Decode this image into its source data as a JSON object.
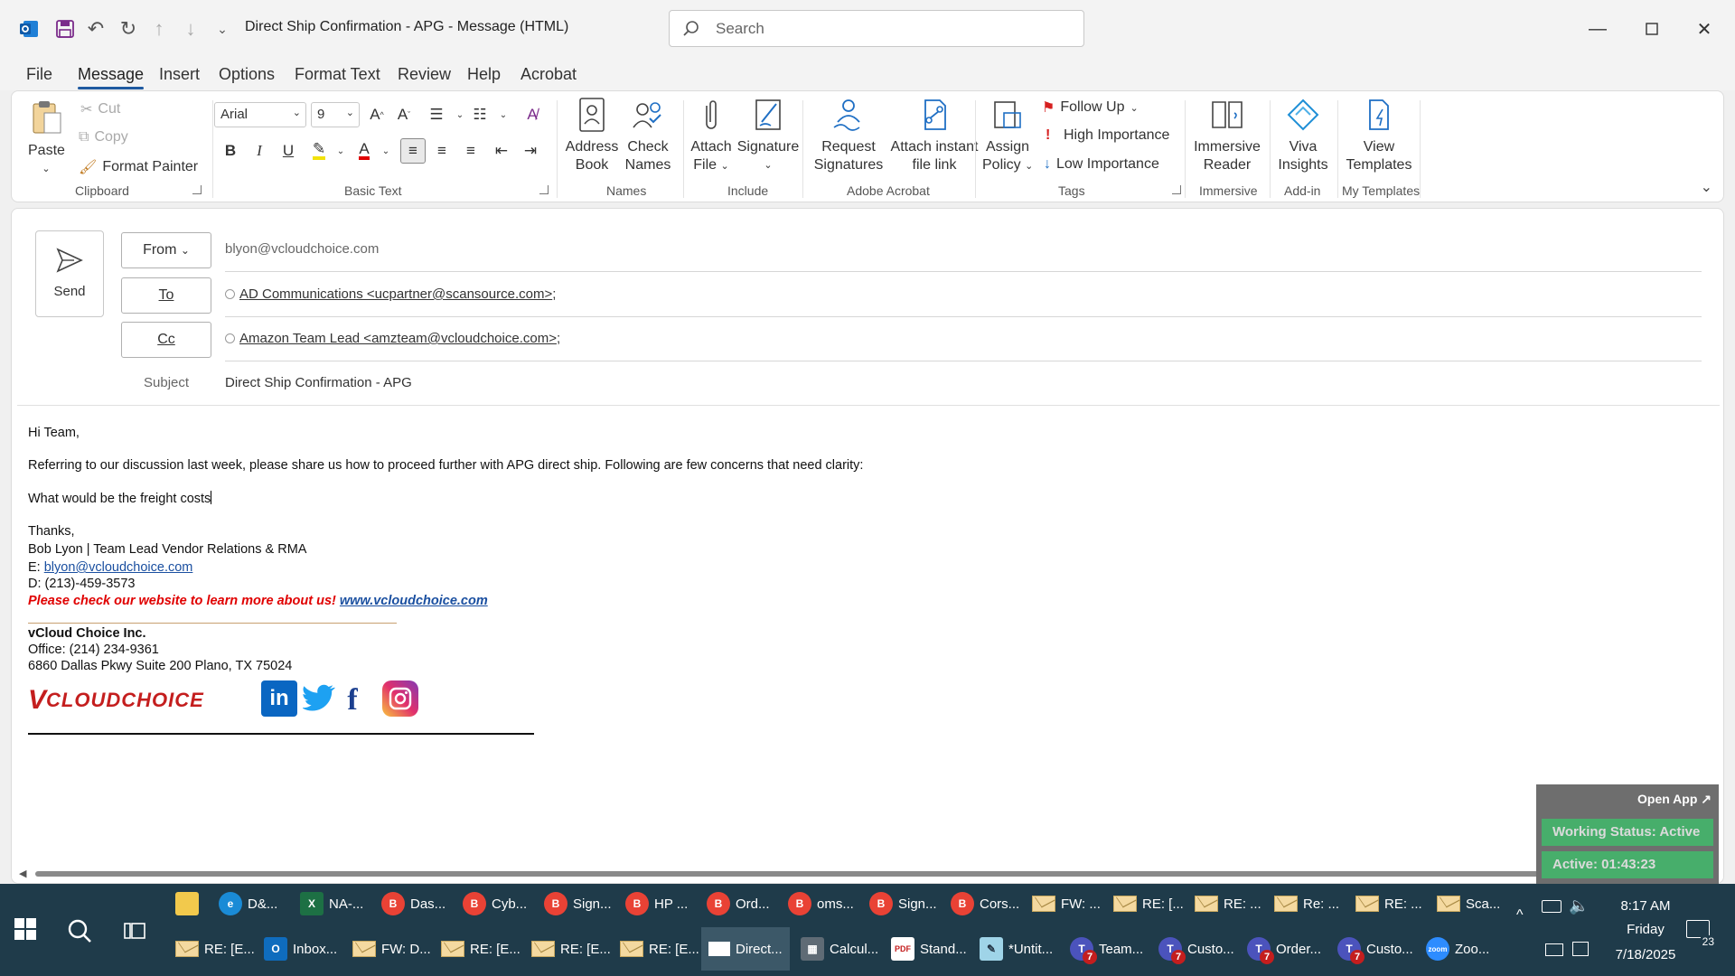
{
  "window": {
    "title": "Direct Ship Confirmation  - APG  -  Message (HTML)",
    "search_placeholder": "Search"
  },
  "menu": {
    "items": [
      "File",
      "Message",
      "Insert",
      "Options",
      "Format Text",
      "Review",
      "Help",
      "Acrobat"
    ],
    "active": "Message"
  },
  "ribbon": {
    "clipboard": {
      "paste": "Paste",
      "cut": "Cut",
      "copy": "Copy",
      "format_painter": "Format Painter",
      "label": "Clipboard"
    },
    "basic_text": {
      "font": "Arial",
      "size": "9",
      "label": "Basic Text"
    },
    "names": {
      "address_book_1": "Address",
      "address_book_2": "Book",
      "check_names_1": "Check",
      "check_names_2": "Names",
      "label": "Names"
    },
    "include": {
      "attach_file_1": "Attach",
      "attach_file_2": "File",
      "signature": "Signature",
      "label": "Include"
    },
    "adobe": {
      "request_1": "Request",
      "request_2": "Signatures",
      "attach_instant_1": "Attach instant",
      "attach_instant_2": "file link",
      "label": "Adobe Acrobat"
    },
    "tags": {
      "assign_1": "Assign",
      "assign_2": "Policy",
      "follow_up": "Follow Up",
      "high": "High Importance",
      "low": "Low Importance",
      "label": "Tags"
    },
    "immersive": {
      "reader_1": "Immersive",
      "reader_2": "Reader",
      "label": "Immersive"
    },
    "addin": {
      "viva_1": "Viva",
      "viva_2": "Insights",
      "label": "Add-in"
    },
    "templates": {
      "view_1": "View",
      "view_2": "Templates",
      "label": "My Templates"
    }
  },
  "compose": {
    "send": "Send",
    "from_label": "From",
    "from_value": "blyon@vcloudchoice.com",
    "to_label": "To",
    "to_value": "AD Communications <ucpartner@scansource.com>",
    "cc_label": "Cc",
    "cc_value": "Amazon Team Lead <amzteam@vcloudchoice.com>",
    "subject_label": "Subject",
    "subject_value": "Direct Ship Confirmation -  APG"
  },
  "body": {
    "greeting": "Hi Team,",
    "line1": "Referring to our discussion last week, please share us how to proceed further with APG direct ship. Following are few concerns that need clarity:",
    "line2": "What would be the freight costs",
    "thanks": "Thanks,",
    "sig_name": "Bob Lyon | Team Lead Vendor Relations & RMA",
    "sig_email_prefix": "E: ",
    "sig_email": "blyon@vcloudchoice.com",
    "sig_phone": "D: (213)-459-3573",
    "sig_promo": "Please check our website to learn more about us!",
    "sig_website": "www.vcloudchoice.com",
    "company": "vCloud Choice Inc.",
    "office": "Office: (214) 234-9361",
    "address": "6860 Dallas Pkwy Suite 200 Plano, TX 75024",
    "logo_text": "VCLOUDCHOICE"
  },
  "work_panel": {
    "open_app": "Open App ↗",
    "status": "Working Status: Active",
    "active": "Active: 01:43:23"
  },
  "taskbar": {
    "row1": [
      "D&...",
      "NA-...",
      "Das...",
      "Cyb...",
      "Sign...",
      "HP ...",
      "Ord...",
      "oms...",
      "Sign...",
      "Cors...",
      "FW: ...",
      "RE: [...",
      "RE: ...",
      "Re: ...",
      "RE: ...",
      "Sca..."
    ],
    "row2": [
      "RE: [E...",
      "Inbox...",
      "FW: D...",
      "RE: [E...",
      "RE: [E...",
      "RE: [E...",
      "Direct...",
      "Calcul...",
      "Stand...",
      "*Untit...",
      "Team...",
      "Custo...",
      "Order...",
      "Custo...",
      "Zoo..."
    ],
    "badge": "7",
    "time": "8:17 AM",
    "day": "Friday",
    "date": "7/18/2025",
    "notif_count": "23"
  },
  "colors": {
    "accent": "#1f5aa0",
    "taskbar": "#1f3b4a",
    "status_green": "#3bc46a",
    "signature_red": "#e00000"
  }
}
